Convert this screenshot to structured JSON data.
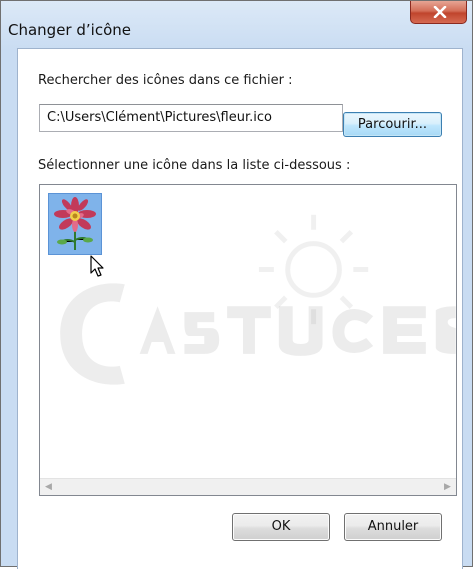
{
  "dialog": {
    "title": "Changer d’icône",
    "close_icon": "close-icon"
  },
  "file_section": {
    "label": "Rechercher des icônes dans ce fichier :",
    "path_value": "C:\\Users\\Clément\\Pictures\\fleur.ico",
    "browse_label": "Parcourir..."
  },
  "icon_section": {
    "label": "Sélectionner une icône dans la liste ci-dessous :",
    "icons": [
      {
        "name": "flower-icon",
        "selected": true
      }
    ]
  },
  "buttons": {
    "ok_label": "OK",
    "cancel_label": "Annuler"
  },
  "colors": {
    "selection": "#7fb3ea",
    "close_button": "#c0452d",
    "focus_border": "#3c7fb1"
  }
}
